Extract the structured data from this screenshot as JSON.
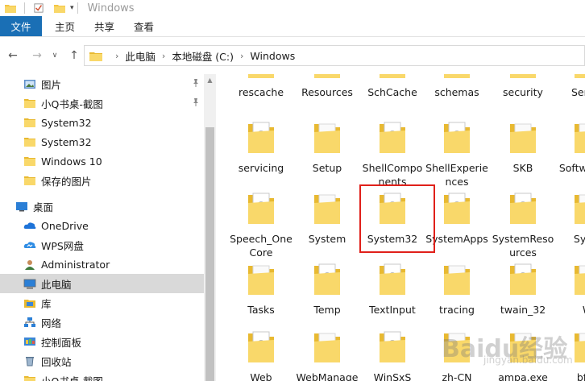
{
  "window": {
    "title": "Windows"
  },
  "ribbon": {
    "tabs": [
      "文件",
      "主页",
      "共享",
      "查看"
    ]
  },
  "address": {
    "crumbs": [
      "此电脑",
      "本地磁盘 (C:)",
      "Windows"
    ]
  },
  "nav": {
    "items": [
      {
        "label": "图片",
        "icon": "pictures-icon",
        "pinned": true
      },
      {
        "label": "小Q书桌-截图",
        "icon": "folder-icon",
        "pinned": true
      },
      {
        "label": "System32",
        "icon": "folder-icon"
      },
      {
        "label": "System32",
        "icon": "folder-icon"
      },
      {
        "label": "Windows 10",
        "icon": "folder-icon"
      },
      {
        "label": "保存的图片",
        "icon": "folder-icon"
      },
      {
        "label": "桌面",
        "icon": "desktop-icon"
      },
      {
        "label": "OneDrive",
        "icon": "onedrive-cloud-icon"
      },
      {
        "label": "WPS网盘",
        "icon": "wps-cloud-icon"
      },
      {
        "label": "Administrator",
        "icon": "user-icon"
      },
      {
        "label": "此电脑",
        "icon": "computer-icon",
        "selected": true
      },
      {
        "label": "库",
        "icon": "library-icon"
      },
      {
        "label": "网络",
        "icon": "network-icon"
      },
      {
        "label": "控制面板",
        "icon": "control-panel-icon"
      },
      {
        "label": "回收站",
        "icon": "recycle-bin-icon"
      },
      {
        "label": "小Q书桌-截图",
        "icon": "folder-icon"
      }
    ]
  },
  "content": {
    "rows": [
      [
        "rescache",
        "Resources",
        "SchCache",
        "schemas",
        "security",
        "Serv fi"
      ],
      [
        "servicing",
        "Setup",
        "ShellComponents",
        "ShellExperiences",
        "SKB",
        "Softw istrib"
      ],
      [
        "Speech_OneCore",
        "System",
        "System32",
        "SystemApps",
        "SystemResources",
        "SysW"
      ],
      [
        "Tasks",
        "Temp",
        "TextInput",
        "tracing",
        "twain_32",
        "W"
      ],
      [
        "Web",
        "WebManagement",
        "WinSxS",
        "zh-CN",
        "ampa.exe",
        "bfsv"
      ]
    ],
    "highlighted": "System32"
  },
  "watermark": {
    "text": "Baidu经验",
    "sub": "jingyan.baidu.com"
  },
  "colors": {
    "accent": "#1a6fb5",
    "folder": "#f7d774",
    "highlight": "#e0201a"
  }
}
